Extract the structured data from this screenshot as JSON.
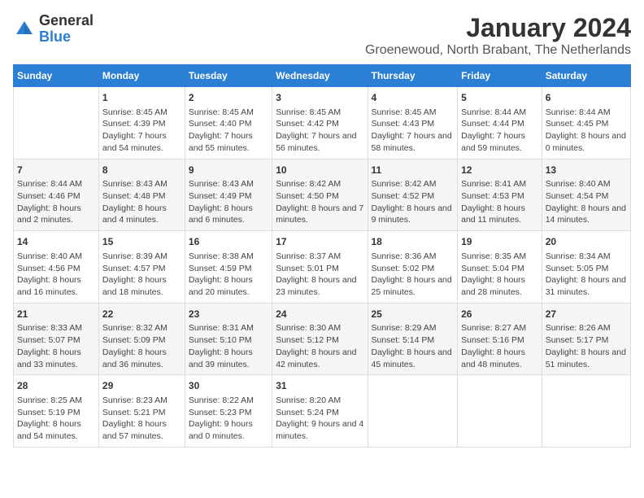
{
  "logo": {
    "general": "General",
    "blue": "Blue"
  },
  "title": "January 2024",
  "subtitle": "Groenewoud, North Brabant, The Netherlands",
  "headers": [
    "Sunday",
    "Monday",
    "Tuesday",
    "Wednesday",
    "Thursday",
    "Friday",
    "Saturday"
  ],
  "weeks": [
    [
      {
        "day": "",
        "sunrise": "",
        "sunset": "",
        "daylight": ""
      },
      {
        "day": "1",
        "sunrise": "Sunrise: 8:45 AM",
        "sunset": "Sunset: 4:39 PM",
        "daylight": "Daylight: 7 hours and 54 minutes."
      },
      {
        "day": "2",
        "sunrise": "Sunrise: 8:45 AM",
        "sunset": "Sunset: 4:40 PM",
        "daylight": "Daylight: 7 hours and 55 minutes."
      },
      {
        "day": "3",
        "sunrise": "Sunrise: 8:45 AM",
        "sunset": "Sunset: 4:42 PM",
        "daylight": "Daylight: 7 hours and 56 minutes."
      },
      {
        "day": "4",
        "sunrise": "Sunrise: 8:45 AM",
        "sunset": "Sunset: 4:43 PM",
        "daylight": "Daylight: 7 hours and 58 minutes."
      },
      {
        "day": "5",
        "sunrise": "Sunrise: 8:44 AM",
        "sunset": "Sunset: 4:44 PM",
        "daylight": "Daylight: 7 hours and 59 minutes."
      },
      {
        "day": "6",
        "sunrise": "Sunrise: 8:44 AM",
        "sunset": "Sunset: 4:45 PM",
        "daylight": "Daylight: 8 hours and 0 minutes."
      }
    ],
    [
      {
        "day": "7",
        "sunrise": "Sunrise: 8:44 AM",
        "sunset": "Sunset: 4:46 PM",
        "daylight": "Daylight: 8 hours and 2 minutes."
      },
      {
        "day": "8",
        "sunrise": "Sunrise: 8:43 AM",
        "sunset": "Sunset: 4:48 PM",
        "daylight": "Daylight: 8 hours and 4 minutes."
      },
      {
        "day": "9",
        "sunrise": "Sunrise: 8:43 AM",
        "sunset": "Sunset: 4:49 PM",
        "daylight": "Daylight: 8 hours and 6 minutes."
      },
      {
        "day": "10",
        "sunrise": "Sunrise: 8:42 AM",
        "sunset": "Sunset: 4:50 PM",
        "daylight": "Daylight: 8 hours and 7 minutes."
      },
      {
        "day": "11",
        "sunrise": "Sunrise: 8:42 AM",
        "sunset": "Sunset: 4:52 PM",
        "daylight": "Daylight: 8 hours and 9 minutes."
      },
      {
        "day": "12",
        "sunrise": "Sunrise: 8:41 AM",
        "sunset": "Sunset: 4:53 PM",
        "daylight": "Daylight: 8 hours and 11 minutes."
      },
      {
        "day": "13",
        "sunrise": "Sunrise: 8:40 AM",
        "sunset": "Sunset: 4:54 PM",
        "daylight": "Daylight: 8 hours and 14 minutes."
      }
    ],
    [
      {
        "day": "14",
        "sunrise": "Sunrise: 8:40 AM",
        "sunset": "Sunset: 4:56 PM",
        "daylight": "Daylight: 8 hours and 16 minutes."
      },
      {
        "day": "15",
        "sunrise": "Sunrise: 8:39 AM",
        "sunset": "Sunset: 4:57 PM",
        "daylight": "Daylight: 8 hours and 18 minutes."
      },
      {
        "day": "16",
        "sunrise": "Sunrise: 8:38 AM",
        "sunset": "Sunset: 4:59 PM",
        "daylight": "Daylight: 8 hours and 20 minutes."
      },
      {
        "day": "17",
        "sunrise": "Sunrise: 8:37 AM",
        "sunset": "Sunset: 5:01 PM",
        "daylight": "Daylight: 8 hours and 23 minutes."
      },
      {
        "day": "18",
        "sunrise": "Sunrise: 8:36 AM",
        "sunset": "Sunset: 5:02 PM",
        "daylight": "Daylight: 8 hours and 25 minutes."
      },
      {
        "day": "19",
        "sunrise": "Sunrise: 8:35 AM",
        "sunset": "Sunset: 5:04 PM",
        "daylight": "Daylight: 8 hours and 28 minutes."
      },
      {
        "day": "20",
        "sunrise": "Sunrise: 8:34 AM",
        "sunset": "Sunset: 5:05 PM",
        "daylight": "Daylight: 8 hours and 31 minutes."
      }
    ],
    [
      {
        "day": "21",
        "sunrise": "Sunrise: 8:33 AM",
        "sunset": "Sunset: 5:07 PM",
        "daylight": "Daylight: 8 hours and 33 minutes."
      },
      {
        "day": "22",
        "sunrise": "Sunrise: 8:32 AM",
        "sunset": "Sunset: 5:09 PM",
        "daylight": "Daylight: 8 hours and 36 minutes."
      },
      {
        "day": "23",
        "sunrise": "Sunrise: 8:31 AM",
        "sunset": "Sunset: 5:10 PM",
        "daylight": "Daylight: 8 hours and 39 minutes."
      },
      {
        "day": "24",
        "sunrise": "Sunrise: 8:30 AM",
        "sunset": "Sunset: 5:12 PM",
        "daylight": "Daylight: 8 hours and 42 minutes."
      },
      {
        "day": "25",
        "sunrise": "Sunrise: 8:29 AM",
        "sunset": "Sunset: 5:14 PM",
        "daylight": "Daylight: 8 hours and 45 minutes."
      },
      {
        "day": "26",
        "sunrise": "Sunrise: 8:27 AM",
        "sunset": "Sunset: 5:16 PM",
        "daylight": "Daylight: 8 hours and 48 minutes."
      },
      {
        "day": "27",
        "sunrise": "Sunrise: 8:26 AM",
        "sunset": "Sunset: 5:17 PM",
        "daylight": "Daylight: 8 hours and 51 minutes."
      }
    ],
    [
      {
        "day": "28",
        "sunrise": "Sunrise: 8:25 AM",
        "sunset": "Sunset: 5:19 PM",
        "daylight": "Daylight: 8 hours and 54 minutes."
      },
      {
        "day": "29",
        "sunrise": "Sunrise: 8:23 AM",
        "sunset": "Sunset: 5:21 PM",
        "daylight": "Daylight: 8 hours and 57 minutes."
      },
      {
        "day": "30",
        "sunrise": "Sunrise: 8:22 AM",
        "sunset": "Sunset: 5:23 PM",
        "daylight": "Daylight: 9 hours and 0 minutes."
      },
      {
        "day": "31",
        "sunrise": "Sunrise: 8:20 AM",
        "sunset": "Sunset: 5:24 PM",
        "daylight": "Daylight: 9 hours and 4 minutes."
      },
      {
        "day": "",
        "sunrise": "",
        "sunset": "",
        "daylight": ""
      },
      {
        "day": "",
        "sunrise": "",
        "sunset": "",
        "daylight": ""
      },
      {
        "day": "",
        "sunrise": "",
        "sunset": "",
        "daylight": ""
      }
    ]
  ]
}
